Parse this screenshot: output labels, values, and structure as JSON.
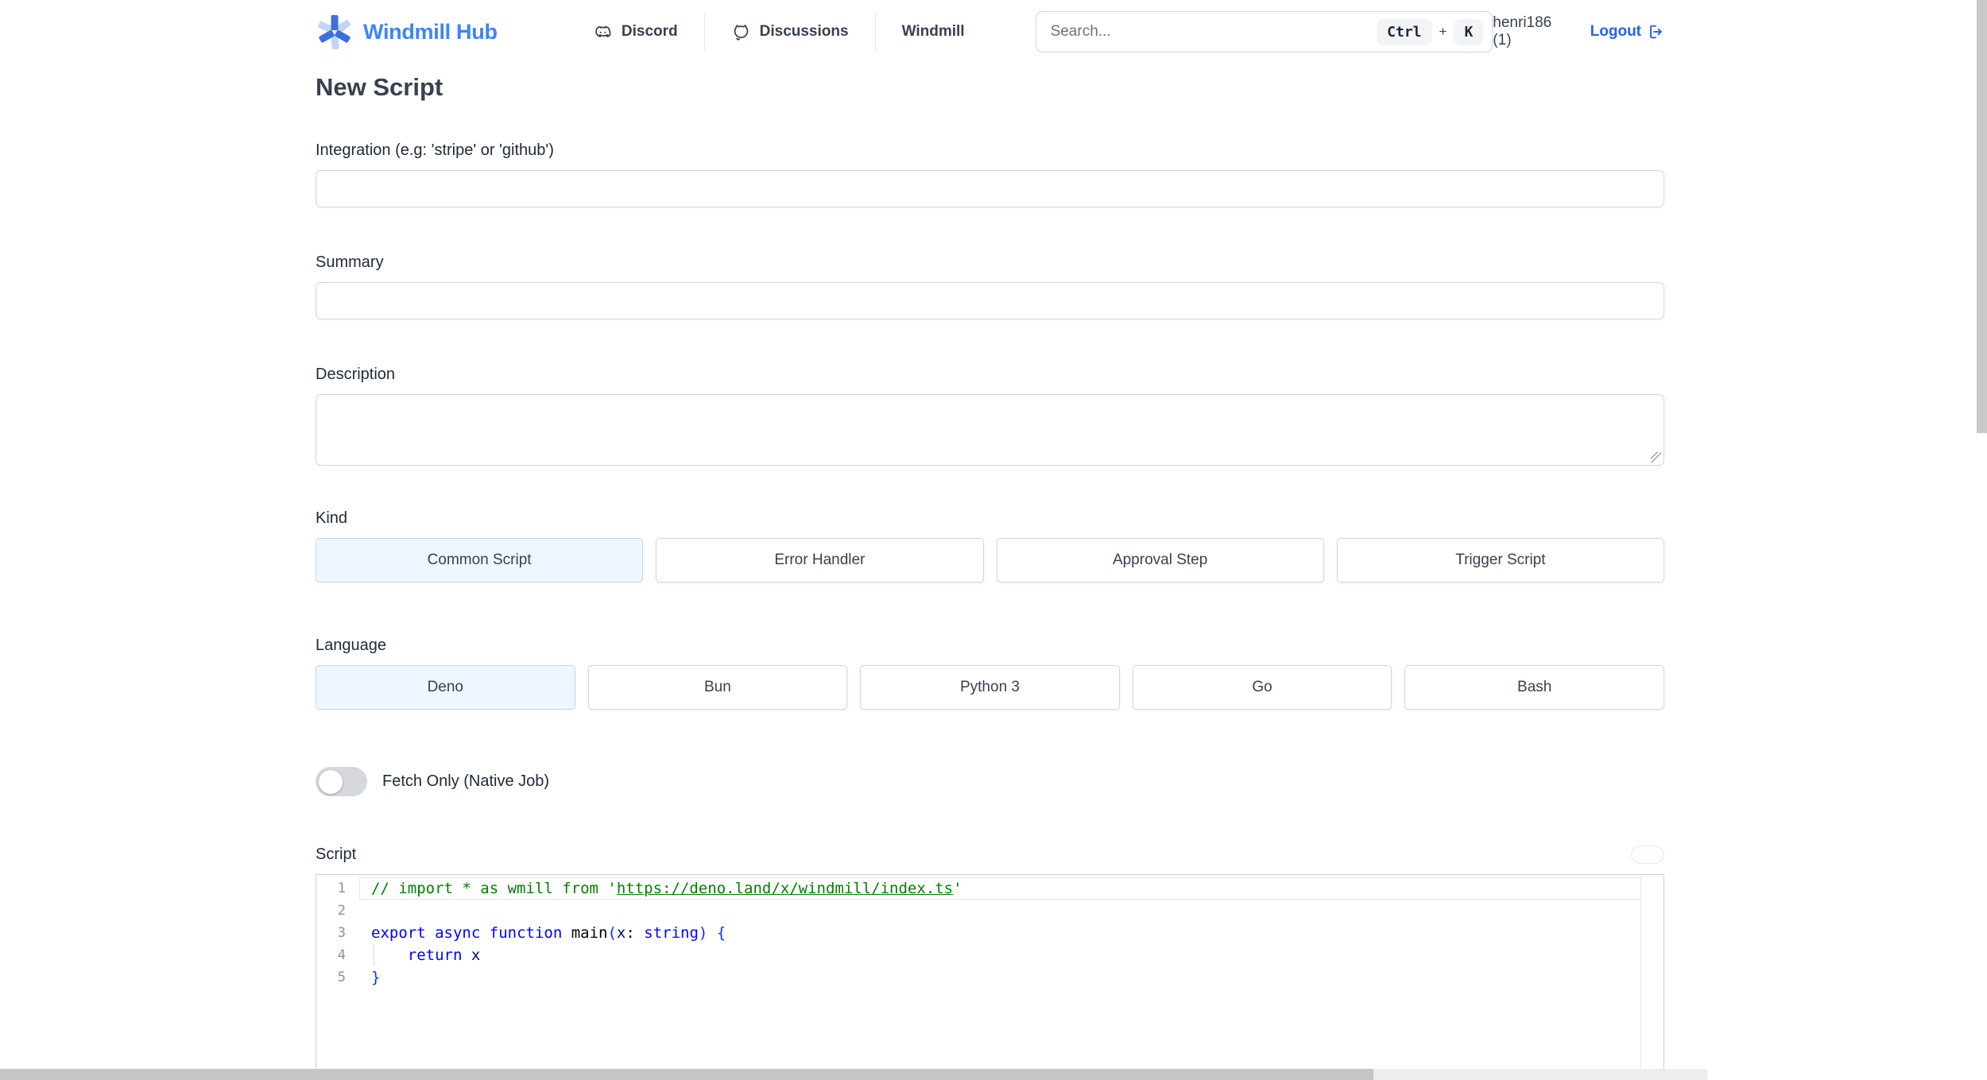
{
  "header": {
    "brand": "Windmill Hub",
    "nav": {
      "discord": "Discord",
      "discussions": "Discussions",
      "windmill": "Windmill"
    },
    "search": {
      "placeholder": "Search...",
      "kbd_ctrl": "Ctrl",
      "kbd_plus": "+",
      "kbd_k": "K"
    },
    "user": "henri186 (1)",
    "logout_label": "Logout"
  },
  "page": {
    "title": "New Script",
    "integration_label": "Integration (e.g: 'stripe' or 'github')",
    "summary_label": "Summary",
    "description_label": "Description",
    "kind": {
      "label": "Kind",
      "options": [
        {
          "label": "Common Script",
          "selected": true
        },
        {
          "label": "Error Handler",
          "selected": false
        },
        {
          "label": "Approval Step",
          "selected": false
        },
        {
          "label": "Trigger Script",
          "selected": false
        }
      ]
    },
    "language": {
      "label": "Language",
      "options": [
        {
          "label": "Deno",
          "selected": true
        },
        {
          "label": "Bun",
          "selected": false
        },
        {
          "label": "Python 3",
          "selected": false
        },
        {
          "label": "Go",
          "selected": false
        },
        {
          "label": "Bash",
          "selected": false
        }
      ]
    },
    "fetch_only_label": "Fetch Only (Native Job)",
    "fetch_only_state": "off"
  },
  "editor": {
    "label": "Script",
    "language": "deno",
    "lines": [
      {
        "num": "1",
        "tokens": [
          {
            "t": "// import * as wmill from '",
            "c": "comment"
          },
          {
            "t": "https://deno.land/x/windmill/index.ts",
            "c": "comment-link"
          },
          {
            "t": "'",
            "c": "comment"
          }
        ]
      },
      {
        "num": "2",
        "tokens": []
      },
      {
        "num": "3",
        "tokens": [
          {
            "t": "export",
            "c": "keyword"
          },
          {
            "t": " ",
            "c": "plain"
          },
          {
            "t": "async",
            "c": "keyword"
          },
          {
            "t": " ",
            "c": "plain"
          },
          {
            "t": "function",
            "c": "keyword"
          },
          {
            "t": " main",
            "c": "plain"
          },
          {
            "t": "(",
            "c": "bracket"
          },
          {
            "t": "x",
            "c": "variable"
          },
          {
            "t": ": ",
            "c": "plain"
          },
          {
            "t": "string",
            "c": "keyword"
          },
          {
            "t": ")",
            "c": "bracket"
          },
          {
            "t": " ",
            "c": "plain"
          },
          {
            "t": "{",
            "c": "bracket"
          }
        ]
      },
      {
        "num": "4",
        "tokens": [
          {
            "t": "    ",
            "c": "plain"
          },
          {
            "t": "return",
            "c": "keyword"
          },
          {
            "t": " ",
            "c": "plain"
          },
          {
            "t": "x",
            "c": "variable"
          }
        ]
      },
      {
        "num": "5",
        "tokens": [
          {
            "t": "}",
            "c": "bracket"
          }
        ]
      }
    ]
  },
  "colors": {
    "brand_blue": "#3f83f8",
    "logout_blue": "#2563eb",
    "selected_option_bg": "#eff6ff",
    "selected_option_border": "#bcd7f7",
    "code_comment": "#008000",
    "code_keyword": "#0000ff",
    "code_variable": "#001080",
    "code_bracket": "#0431fa",
    "scrollbar_thumb": "#c9c9c9"
  }
}
